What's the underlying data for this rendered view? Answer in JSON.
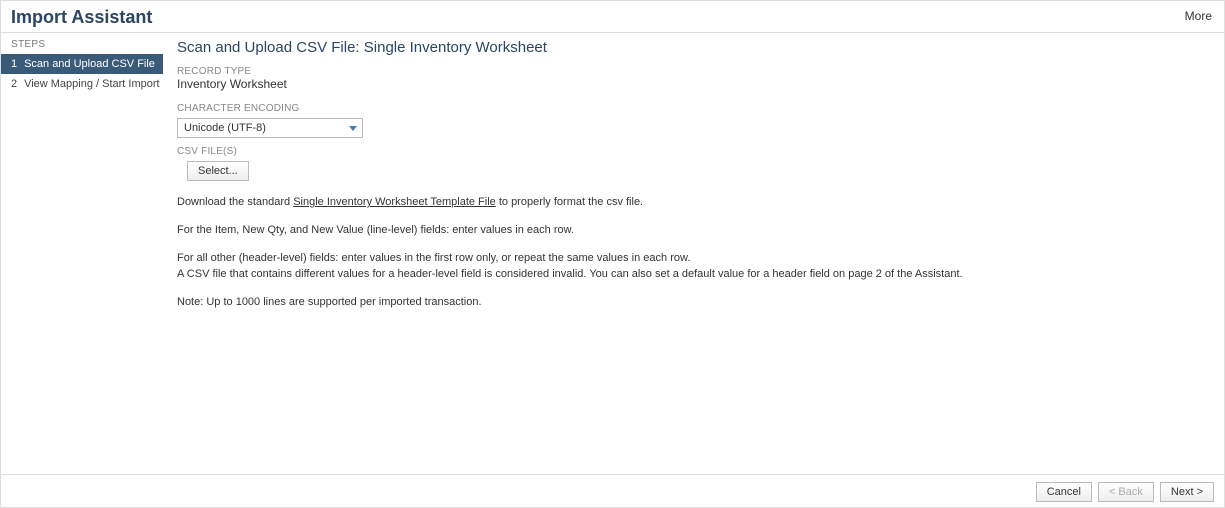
{
  "header": {
    "title": "Import Assistant",
    "more": "More"
  },
  "sidebar": {
    "steps_label": "STEPS",
    "items": [
      {
        "num": "1",
        "label": "Scan and Upload CSV File",
        "active": true
      },
      {
        "num": "2",
        "label": "View Mapping / Start Import",
        "active": false
      }
    ]
  },
  "main": {
    "title": "Scan and Upload CSV File: Single Inventory Worksheet",
    "record_type_label": "RECORD TYPE",
    "record_type_value": "Inventory Worksheet",
    "encoding_label": "CHARACTER ENCODING",
    "encoding_value": "Unicode (UTF-8)",
    "csv_label": "CSV FILE(S)",
    "select_button": "Select...",
    "download_prefix": "Download the standard ",
    "download_link": "Single Inventory Worksheet Template File",
    "download_suffix": " to properly format the csv file.",
    "para2": "For the Item, New Qty, and New Value (line-level) fields: enter values in each row.",
    "para3a": "For all other (header-level) fields: enter values in the first row only, or repeat the same values in each row.",
    "para3b": "A CSV file that contains different values for a header-level field is considered invalid. You can also set a default value for a header field on page 2 of the Assistant.",
    "para4": "Note: Up to 1000 lines are supported per imported transaction."
  },
  "footer": {
    "cancel": "Cancel",
    "back": "< Back",
    "next": "Next >"
  }
}
